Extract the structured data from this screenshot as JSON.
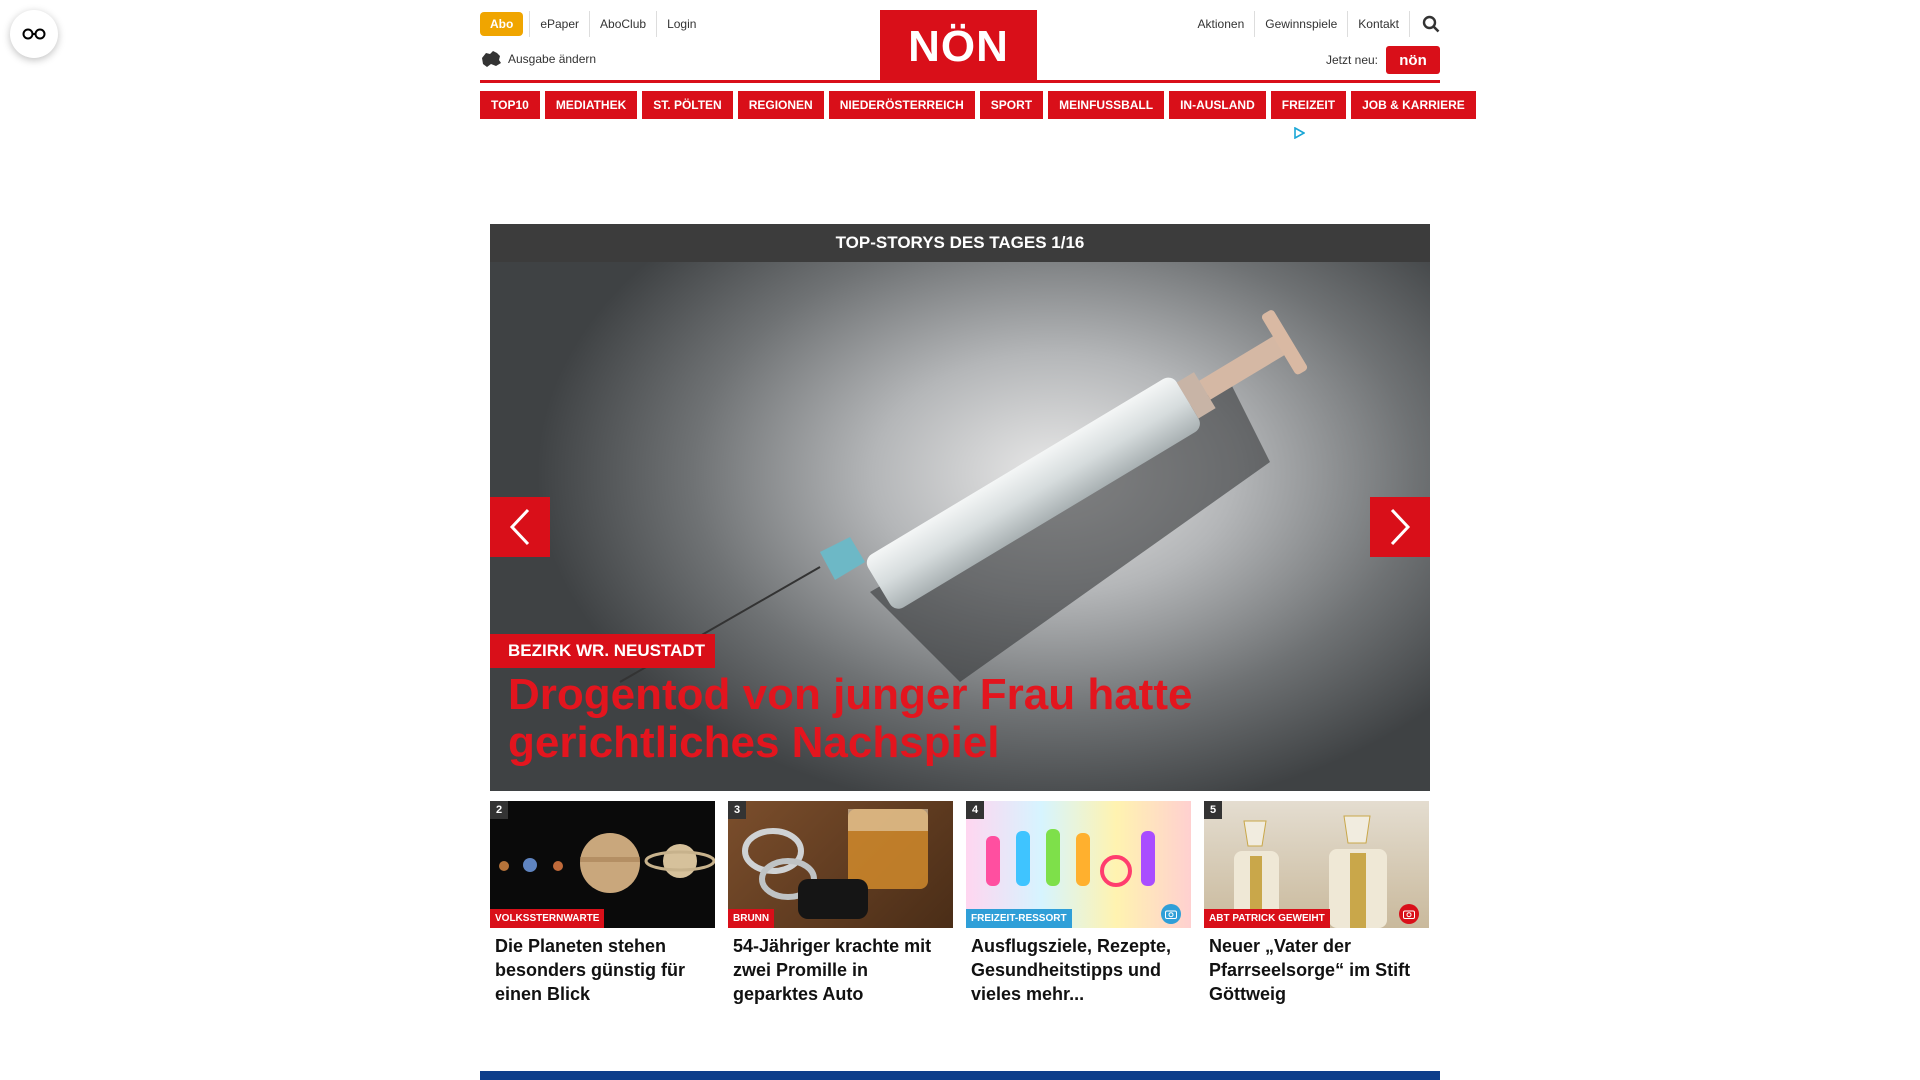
{
  "header": {
    "abo": "Abo",
    "utility_left": [
      "ePaper",
      "AboClub",
      "Login"
    ],
    "edition": "Ausgabe ändern",
    "logo": "NÖN",
    "utility_right": [
      "Aktionen",
      "Gewinnspiele",
      "Kontakt"
    ],
    "jetzt_label": "Jetzt neu:",
    "jetzt_badge": "nön"
  },
  "nav": [
    "TOP10",
    "MEDIATHEK",
    "ST. PÖLTEN",
    "REGIONEN",
    "NIEDERÖSTERREICH",
    "SPORT",
    "MEINFUSSBALL",
    "IN-AUSLAND",
    "FREIZEIT",
    "JOB & KARRIERE"
  ],
  "slider": {
    "heading": "TOP-STORYS DES TAGES 1/16",
    "kicker": "BEZIRK WR. NEUSTADT",
    "title": "Drogentod von junger Frau hatte gerichtliches Nachspiel"
  },
  "cards": [
    {
      "num": "2",
      "tag": "VOLKSSTERNWARTE",
      "tag_color": "#d90f19",
      "title": "Die Planeten stehen besonders günstig für einen Blick",
      "camera": false
    },
    {
      "num": "3",
      "tag": "BRUNN",
      "tag_color": "#d90f19",
      "title": "54-Jähriger krachte mit zwei Promille in geparktes Auto",
      "camera": false
    },
    {
      "num": "4",
      "tag": "FREIZEIT-RESSORT",
      "tag_color": "#2f9fd8",
      "title": "Ausflugsziele, Rezepte, Gesundheitstipps und vieles mehr...",
      "camera": true,
      "camera_color": "#2f9fd8"
    },
    {
      "num": "5",
      "tag": "ABT PATRICK GEWEIHT",
      "tag_color": "#d90f19",
      "title": "Neuer „Vater der Pfarrseelsorge“ im Stift Göttweig",
      "camera": true,
      "camera_color": "#d90f19"
    }
  ],
  "colors": {
    "brand_red": "#d90f19",
    "abo_orange": "#f0a500",
    "footer_blue": "#0e3e8a"
  }
}
